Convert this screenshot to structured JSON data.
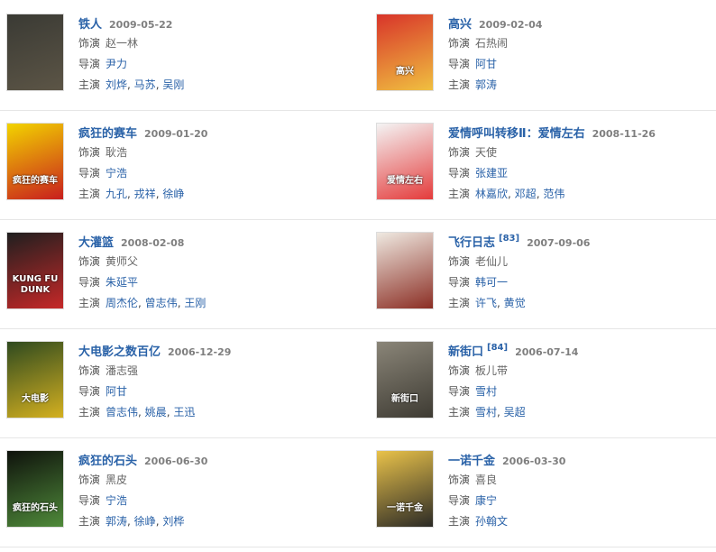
{
  "labels": {
    "role": "饰演",
    "director": "导演",
    "cast": "主演"
  },
  "films": [
    {
      "title": "铁人",
      "date": "2009-05-22",
      "role": "赵一林",
      "director": [
        "尹力"
      ],
      "cast": [
        "刘烨",
        "马苏",
        "吴刚"
      ],
      "poster": {
        "text": "",
        "colors": [
          "#3a3a34",
          "#5c5546"
        ]
      }
    },
    {
      "title": "高兴",
      "date": "2009-02-04",
      "role": "石热闹",
      "director": [
        "阿甘"
      ],
      "cast": [
        "郭涛"
      ],
      "poster": {
        "text": "高兴",
        "colors": [
          "#d8342a",
          "#f0c040"
        ]
      }
    },
    {
      "title": "疯狂的赛车",
      "date": "2009-01-20",
      "role": "耿浩",
      "director": [
        "宁浩"
      ],
      "cast": [
        "九孔",
        "戎祥",
        "徐峥"
      ],
      "poster": {
        "text": "疯狂的赛车",
        "colors": [
          "#f2d400",
          "#c81e1e"
        ]
      }
    },
    {
      "title": "爱情呼叫转移Ⅱ：爱情左右",
      "date": "2008-11-26",
      "role": "天使",
      "director": [
        "张建亚"
      ],
      "cast": [
        "林嘉欣",
        "邓超",
        "范伟"
      ],
      "poster": {
        "text": "爱情左右",
        "colors": [
          "#f4f4f4",
          "#e43b3b"
        ]
      }
    },
    {
      "title": "大灌篮",
      "date": "2008-02-08",
      "role": "黄师父",
      "director": [
        "朱延平"
      ],
      "cast": [
        "周杰伦",
        "曾志伟",
        "王刚"
      ],
      "poster": {
        "text": "KUNG FU DUNK",
        "colors": [
          "#1f1f1f",
          "#c62828"
        ]
      }
    },
    {
      "title": "飞行日志",
      "sup": "[83]",
      "date": "2007-09-06",
      "role": "老仙儿",
      "director": [
        "韩可一"
      ],
      "cast": [
        "许飞",
        "黄觉"
      ],
      "poster": {
        "text": "",
        "colors": [
          "#efe9e1",
          "#8b2e24"
        ]
      }
    },
    {
      "title": "大电影之数百亿",
      "date": "2006-12-29",
      "role": "潘志强",
      "director": [
        "阿甘"
      ],
      "cast": [
        "曾志伟",
        "姚晨",
        "王迅"
      ],
      "poster": {
        "text": "大电影",
        "colors": [
          "#2f4a1f",
          "#d4b020"
        ]
      }
    },
    {
      "title": "新街口",
      "sup": "[84]",
      "date": "2006-07-14",
      "role": "板儿带",
      "director": [
        "雪村"
      ],
      "cast": [
        "雪村",
        "吴超"
      ],
      "poster": {
        "text": "新街口",
        "colors": [
          "#8a8578",
          "#3e3b33"
        ]
      }
    },
    {
      "title": "疯狂的石头",
      "date": "2006-06-30",
      "role": "黑皮",
      "director": [
        "宁浩"
      ],
      "cast": [
        "郭涛",
        "徐峥",
        "刘桦"
      ],
      "poster": {
        "text": "疯狂的石头",
        "colors": [
          "#0f120c",
          "#4f8a3a"
        ]
      }
    },
    {
      "title": "一诺千金",
      "date": "2006-03-30",
      "role": "喜良",
      "director": [
        "康宁"
      ],
      "cast": [
        "孙翰文"
      ],
      "poster": {
        "text": "一诺千金",
        "colors": [
          "#e9c24a",
          "#2b2a26"
        ]
      }
    }
  ]
}
